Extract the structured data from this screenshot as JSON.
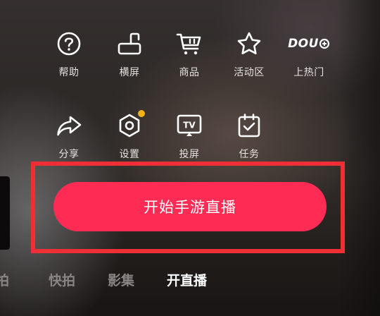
{
  "grid": {
    "row1": [
      {
        "label": "帮助",
        "icon": "help-icon"
      },
      {
        "label": "横屏",
        "icon": "landscape-rotate-icon"
      },
      {
        "label": "商品",
        "icon": "shopping-cart-icon"
      },
      {
        "label": "活动区",
        "icon": "star-icon"
      },
      {
        "label": "上热门",
        "icon": "dou-plus-icon",
        "icon_text": "DOU"
      }
    ],
    "row2": [
      {
        "label": "分享",
        "icon": "share-icon"
      },
      {
        "label": "设置",
        "icon": "settings-hexagon-icon",
        "badge_color": "#f4b419"
      },
      {
        "label": "投屏",
        "icon": "cast-tv-icon",
        "icon_text": "TV"
      },
      {
        "label": "任务",
        "icon": "task-calendar-check-icon"
      }
    ]
  },
  "primary_button": {
    "label": "开始手游直播",
    "color": "#fe2c55"
  },
  "highlight_color": "#ee2f36",
  "bottom_tabs": [
    {
      "label": "拍",
      "active": false
    },
    {
      "label": "快拍",
      "active": false
    },
    {
      "label": "影集",
      "active": false
    },
    {
      "label": "开直播",
      "active": true
    }
  ]
}
